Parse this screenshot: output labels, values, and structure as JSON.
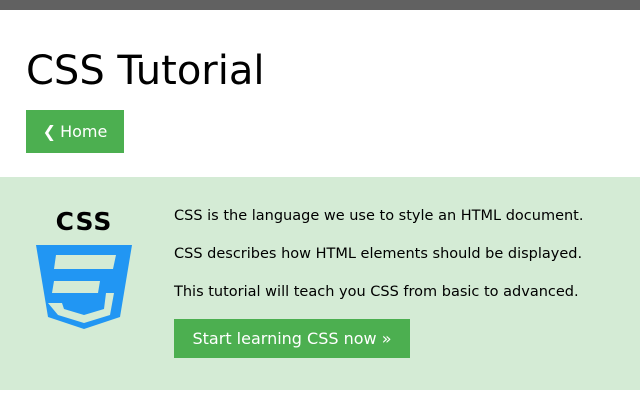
{
  "header": {
    "title": "CSS Tutorial",
    "home_chevron": "❮",
    "home_label": "Home"
  },
  "hero": {
    "logo_text": "CSS",
    "logo_icon": "css3-shield-icon",
    "lines": [
      "CSS is the language we use to style an HTML document.",
      "CSS describes how HTML elements should be displayed.",
      "This tutorial will teach you CSS from basic to advanced."
    ],
    "cta_label": "Start learning CSS now »"
  },
  "colors": {
    "accent": "#4caf50",
    "hero_background": "#d4ebd5",
    "topbar": "#616161",
    "css_logo_blue": "#2196f3"
  }
}
